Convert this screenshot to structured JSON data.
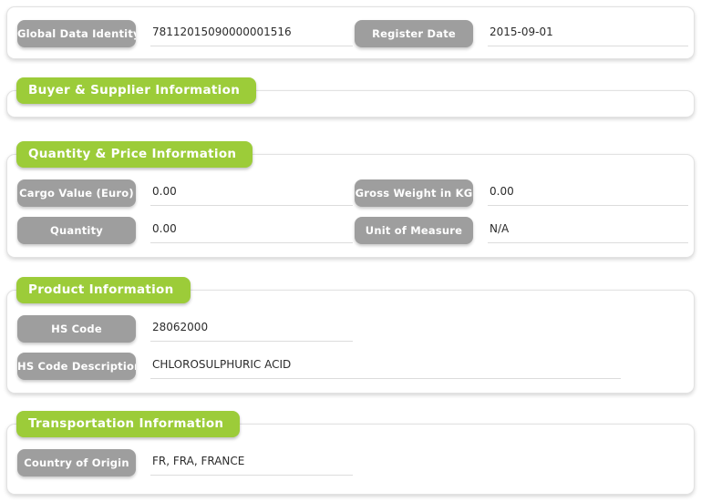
{
  "sections": [
    {
      "id": "identity",
      "header": null,
      "fields": [
        {
          "label": "Global Data Identity",
          "value": "78112015090000001516"
        },
        {
          "label": "Register Date",
          "value": "2015-09-01"
        }
      ]
    },
    {
      "id": "buyer-supplier",
      "header": "Buyer & Supplier Information",
      "fields": []
    },
    {
      "id": "quantity-price",
      "header": "Quantity & Price Information",
      "fields": [
        {
          "label": "Cargo Value (Euro)",
          "value": "0.00"
        },
        {
          "label": "Gross Weight in KG",
          "value": "0.00"
        },
        {
          "label": "Quantity",
          "value": "0.00"
        },
        {
          "label": "Unit of Measure",
          "value": "N/A"
        }
      ]
    },
    {
      "id": "product",
      "header": "Product Information",
      "fields": [
        {
          "label": "HS Code",
          "value": "28062000"
        },
        {
          "label": "HS Code Description",
          "value": "CHLOROSULPHURIC ACID"
        }
      ]
    },
    {
      "id": "transportation",
      "header": "Transportation Information",
      "fields": [
        {
          "label": "Country of Origin",
          "value": "FR, FRA, FRANCE"
        }
      ]
    }
  ],
  "colors": {
    "section_header_green": "#9ccc39",
    "field_label_gray": "#9e9e9e",
    "panel_background": "#ffffff",
    "value_text": "#2b2b2b",
    "underline": "#dcdcdc"
  }
}
